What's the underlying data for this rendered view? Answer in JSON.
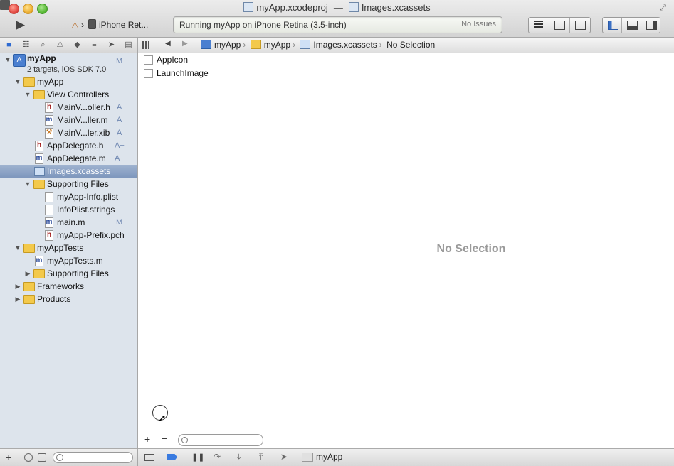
{
  "window": {
    "title_project": "myApp.xcodeproj",
    "title_separator": "—",
    "title_file": "Images.xcassets"
  },
  "toolbar": {
    "scheme_device": "iPhone Ret...",
    "activity_status": "Running myApp on iPhone Retina (3.5-inch)",
    "issues_label": "No Issues"
  },
  "navigator": {
    "project_name": "myApp",
    "project_subtitle": "2 targets, iOS SDK 7.0",
    "project_badge": "M",
    "items": [
      {
        "label": "myApp",
        "kind": "folder",
        "depth": 1,
        "expanded": true,
        "badge": ""
      },
      {
        "label": "View Controllers",
        "kind": "folder",
        "depth": 2,
        "expanded": true,
        "badge": ""
      },
      {
        "label": "MainV...oller.h",
        "kind": "h",
        "depth": 3,
        "badge": "A"
      },
      {
        "label": "MainV...ller.m",
        "kind": "m",
        "depth": 3,
        "badge": "A"
      },
      {
        "label": "MainV...ler.xib",
        "kind": "xib",
        "depth": 3,
        "badge": "A"
      },
      {
        "label": "AppDelegate.h",
        "kind": "h",
        "depth": 2,
        "badge": "A+"
      },
      {
        "label": "AppDelegate.m",
        "kind": "m",
        "depth": 2,
        "badge": "A+"
      },
      {
        "label": "Images.xcassets",
        "kind": "xcassets",
        "depth": 2,
        "badge": "",
        "selected": true
      },
      {
        "label": "Supporting Files",
        "kind": "folder",
        "depth": 2,
        "expanded": true,
        "badge": ""
      },
      {
        "label": "myApp-Info.plist",
        "kind": "plist",
        "depth": 3,
        "badge": ""
      },
      {
        "label": "InfoPlist.strings",
        "kind": "plist",
        "depth": 3,
        "badge": ""
      },
      {
        "label": "main.m",
        "kind": "m",
        "depth": 3,
        "badge": "M"
      },
      {
        "label": "myApp-Prefix.pch",
        "kind": "h",
        "depth": 3,
        "badge": ""
      },
      {
        "label": "myAppTests",
        "kind": "folder",
        "depth": 1,
        "expanded": true,
        "badge": ""
      },
      {
        "label": "myAppTests.m",
        "kind": "m",
        "depth": 2,
        "badge": ""
      },
      {
        "label": "Supporting Files",
        "kind": "folder",
        "depth": 2,
        "expanded": false,
        "badge": ""
      },
      {
        "label": "Frameworks",
        "kind": "folder",
        "depth": 1,
        "expanded": false,
        "badge": ""
      },
      {
        "label": "Products",
        "kind": "folder",
        "depth": 1,
        "expanded": false,
        "badge": ""
      }
    ]
  },
  "jumpbar": {
    "crumbs": [
      "myApp",
      "myApp",
      "Images.xcassets",
      "No Selection"
    ]
  },
  "asset_sets": [
    "AppIcon",
    "LaunchImage"
  ],
  "editor": {
    "empty_message": "No Selection"
  },
  "debugbar": {
    "target_label": "myApp"
  }
}
